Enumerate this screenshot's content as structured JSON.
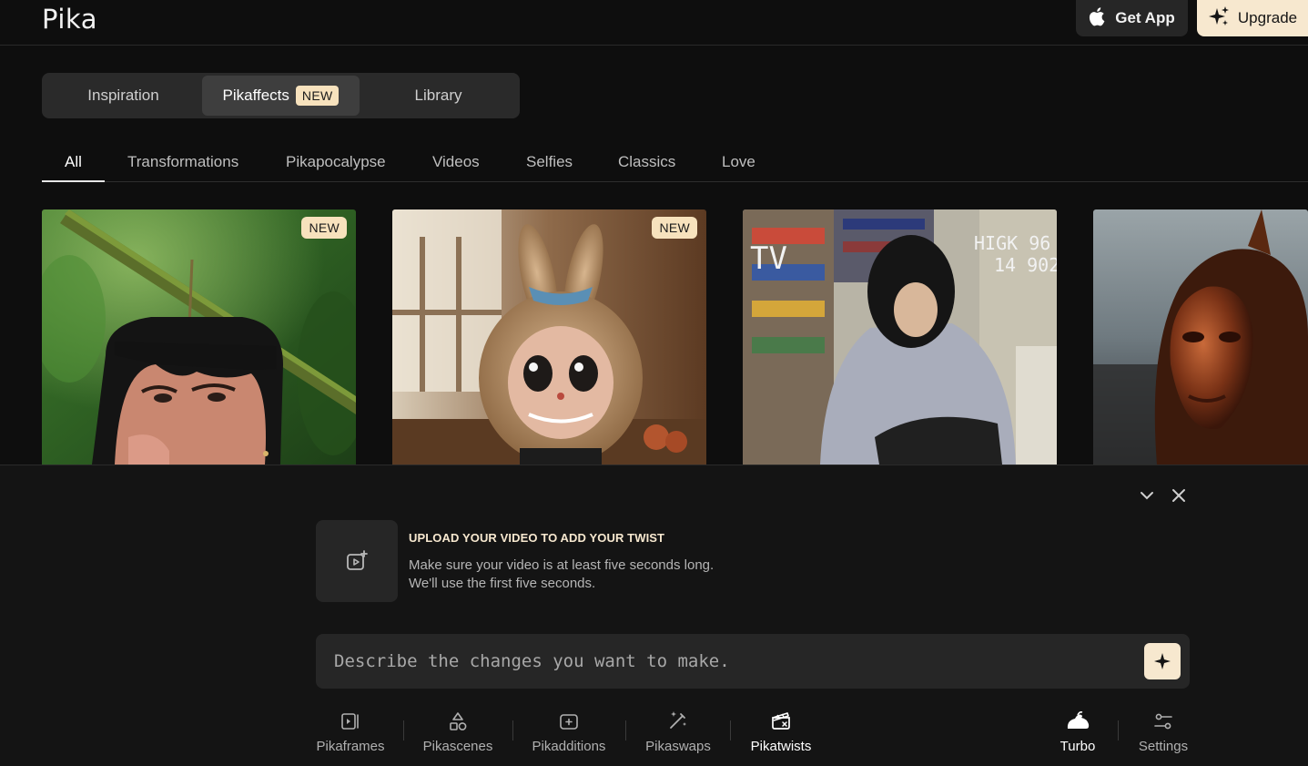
{
  "header": {
    "logo": "Pika",
    "get_app_label": "Get App",
    "upgrade_label": "Upgrade"
  },
  "top_tabs": [
    {
      "label": "Inspiration",
      "active": false
    },
    {
      "label": "Pikaffects",
      "badge": "NEW",
      "active": true
    },
    {
      "label": "Library",
      "active": false
    }
  ],
  "categories": [
    {
      "label": "All",
      "active": true
    },
    {
      "label": "Transformations"
    },
    {
      "label": "Pikapocalypse"
    },
    {
      "label": "Videos"
    },
    {
      "label": "Selfies"
    },
    {
      "label": "Classics"
    },
    {
      "label": "Love"
    }
  ],
  "cards": [
    {
      "badge": "NEW"
    },
    {
      "badge": "NEW"
    },
    {
      "badge": "",
      "overlay_text": [
        "TV",
        "HIGK 96",
        "14 902"
      ]
    },
    {
      "badge": ""
    }
  ],
  "panel": {
    "upload_title": "UPLOAD YOUR VIDEO TO ADD YOUR TWIST",
    "upload_desc_line1": "Make sure your video is at least five seconds long.",
    "upload_desc_line2": "We'll use the first five seconds.",
    "prompt_placeholder": "Describe the changes you want to make.",
    "tools": [
      {
        "label": "Pikaframes",
        "icon": "frames-icon"
      },
      {
        "label": "Pikascenes",
        "icon": "shapes-icon"
      },
      {
        "label": "Pikadditions",
        "icon": "add-layer-icon"
      },
      {
        "label": "Pikaswaps",
        "icon": "magic-wand-icon"
      },
      {
        "label": "Pikatwists",
        "icon": "clapperboard-icon",
        "active": true
      },
      {
        "label": "Turbo",
        "icon": "rabbit-icon"
      },
      {
        "label": "Settings",
        "icon": "sliders-icon"
      }
    ]
  },
  "colors": {
    "background": "#0e0e0e",
    "accent_cream": "#f7e8cf",
    "badge": "#f7e2bd",
    "surface": "#262626"
  }
}
